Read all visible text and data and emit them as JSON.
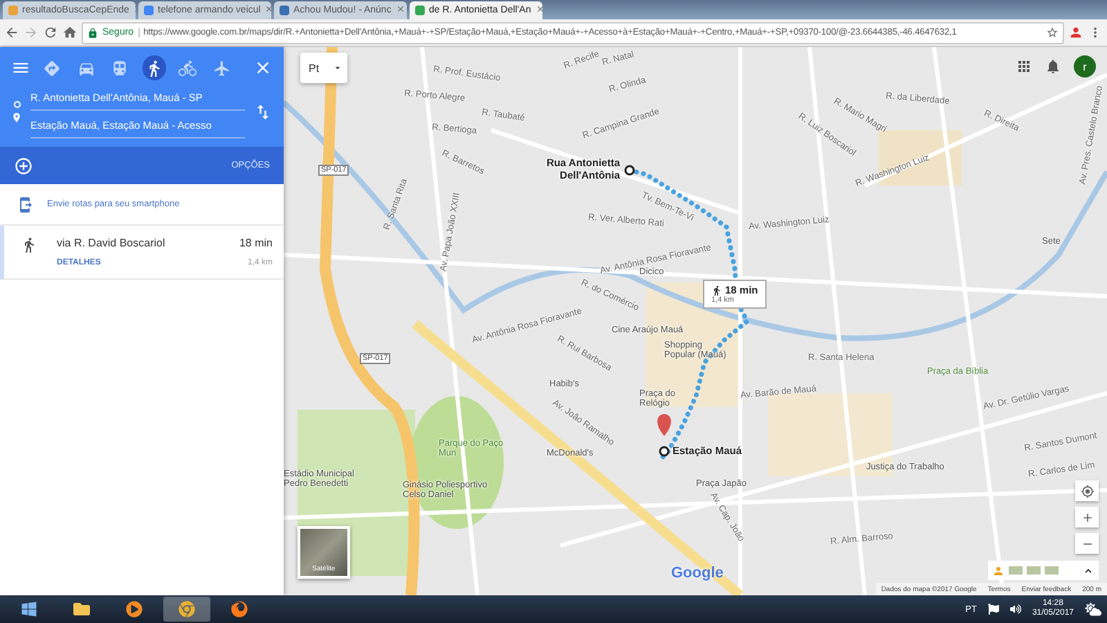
{
  "browser": {
    "tabs": [
      {
        "title": "resultadoBuscaCepEnde",
        "selected": false
      },
      {
        "title": "telefone armando veicul",
        "selected": false
      },
      {
        "title": "Achou Mudou! - Anúnc",
        "selected": false
      },
      {
        "title": "de R. Antonietta Dell'An",
        "selected": true
      }
    ],
    "secure_label": "Seguro",
    "url": "https://www.google.com.br/maps/dir/R.+Antonietta+Dell'Antônia,+Mauá+-+SP/Estação+Mauá,+Estação+Mauá+-+Acesso+à+Estação+Mauá+-+Centro,+Mauá+-+SP,+09370-100/@-23.6644385,-46.4647632,1"
  },
  "directions": {
    "modes": [
      {
        "kind": "best",
        "selected": false
      },
      {
        "kind": "car",
        "selected": false
      },
      {
        "kind": "transit",
        "selected": false
      },
      {
        "kind": "walk",
        "selected": true
      },
      {
        "kind": "bike",
        "selected": false
      },
      {
        "kind": "flight",
        "selected": false
      }
    ],
    "origin": "R. Antonietta Dell'Antônia, Mauá - SP",
    "destination": "Estação Mauá, Estação Mauá - Acesso",
    "options_label": "OPÇÕES",
    "send_label": "Envie rotas para seu smartphone",
    "routes": [
      {
        "via": "via R. David Boscariol",
        "time": "18 min",
        "details_label": "DETALHES",
        "distance": "1,4 km",
        "selected": true
      }
    ]
  },
  "map": {
    "language": "Pt",
    "avatar": "r",
    "labels": [
      {
        "text": "Rua Antonietta Dell'Antônia",
        "kind": "endpoint"
      },
      {
        "text": "Estação Mauá",
        "kind": "endpoint"
      },
      {
        "text": "R. Recife",
        "kind": "street"
      },
      {
        "text": "R. Natal",
        "kind": "street"
      },
      {
        "text": "R. Prof. Eustácio",
        "kind": "street"
      },
      {
        "text": "R. Porto Alegre",
        "kind": "street"
      },
      {
        "text": "R. Taubaté",
        "kind": "street"
      },
      {
        "text": "R. Bertioga",
        "kind": "street"
      },
      {
        "text": "R. Barretos",
        "kind": "street"
      },
      {
        "text": "R. Olinda",
        "kind": "street"
      },
      {
        "text": "R. Campina Grande",
        "kind": "street"
      },
      {
        "text": "Tv. Bem-Te-Vi",
        "kind": "street"
      },
      {
        "text": "Av. Antônia Rosa Fioravante",
        "kind": "street"
      },
      {
        "text": "Av. Antônia Rosa Fioravante",
        "kind": "street"
      },
      {
        "text": "R. do Comércio",
        "kind": "street"
      },
      {
        "text": "Dicico",
        "kind": "place"
      },
      {
        "text": "Cine Araújo Mauá",
        "kind": "place"
      },
      {
        "text": "Shopping Popular (Mauá)",
        "kind": "place"
      },
      {
        "text": "Praça do Relógio",
        "kind": "place"
      },
      {
        "text": "Habib's",
        "kind": "place"
      },
      {
        "text": "Parque do Paço Mun",
        "kind": "park"
      },
      {
        "text": "Av. João Ramalho",
        "kind": "street"
      },
      {
        "text": "McDonald's",
        "kind": "place"
      },
      {
        "text": "Estádio Municipal Pedro Benedetti",
        "kind": "place"
      },
      {
        "text": "Ginásio Poliesportivo Celso Daniel",
        "kind": "place"
      },
      {
        "text": "Praça Japão",
        "kind": "place"
      },
      {
        "text": "Av. Cap. João",
        "kind": "street"
      },
      {
        "text": "R. Santa Helena",
        "kind": "street"
      },
      {
        "text": "Praça da Bíblia",
        "kind": "park"
      },
      {
        "text": "Av. Barão de Mauá",
        "kind": "street"
      },
      {
        "text": "Av. Dr. Getúlio Vargas",
        "kind": "street"
      },
      {
        "text": "Justiça do Trabalho",
        "kind": "place"
      },
      {
        "text": "R. Santos Dumont",
        "kind": "street"
      },
      {
        "text": "R. Carlos de Lim",
        "kind": "street"
      },
      {
        "text": "R. Alm. Barroso",
        "kind": "street"
      },
      {
        "text": "Av. Washington Luiz",
        "kind": "street"
      },
      {
        "text": "R. Washington Luiz",
        "kind": "street"
      },
      {
        "text": "R. Luiz Boscariol",
        "kind": "street"
      },
      {
        "text": "R. da Liberdade",
        "kind": "street"
      },
      {
        "text": "R. Mario Magri",
        "kind": "street"
      },
      {
        "text": "R. Direita",
        "kind": "street"
      },
      {
        "text": "Sete",
        "kind": "place"
      },
      {
        "text": "R. Santa Rita",
        "kind": "street"
      },
      {
        "text": "Av. Papa João XXIII",
        "kind": "street"
      },
      {
        "text": "R. Ver. Alberto Rati",
        "kind": "street"
      },
      {
        "text": "R. Rui Barbosa",
        "kind": "street"
      },
      {
        "text": "Av. Pres. Castelo Branco",
        "kind": "street"
      },
      {
        "text": "SP-017",
        "kind": "shield"
      },
      {
        "text": "SP-017",
        "kind": "shield"
      }
    ],
    "route_badge": {
      "time": "18 min",
      "distance": "1,4 km"
    },
    "satellite_label": "Satélite",
    "logo": "Google",
    "footer": [
      "Dados do mapa ©2017 Google",
      "Termos",
      "Enviar feedback",
      "200 m"
    ]
  },
  "taskbar": {
    "apps": [
      {
        "kind": "explorer",
        "selected": false
      },
      {
        "kind": "media",
        "selected": false
      },
      {
        "kind": "chrome",
        "selected": true
      },
      {
        "kind": "firefox",
        "selected": false
      }
    ],
    "language": "PT",
    "time": "14:28",
    "date": "31/05/2017"
  }
}
